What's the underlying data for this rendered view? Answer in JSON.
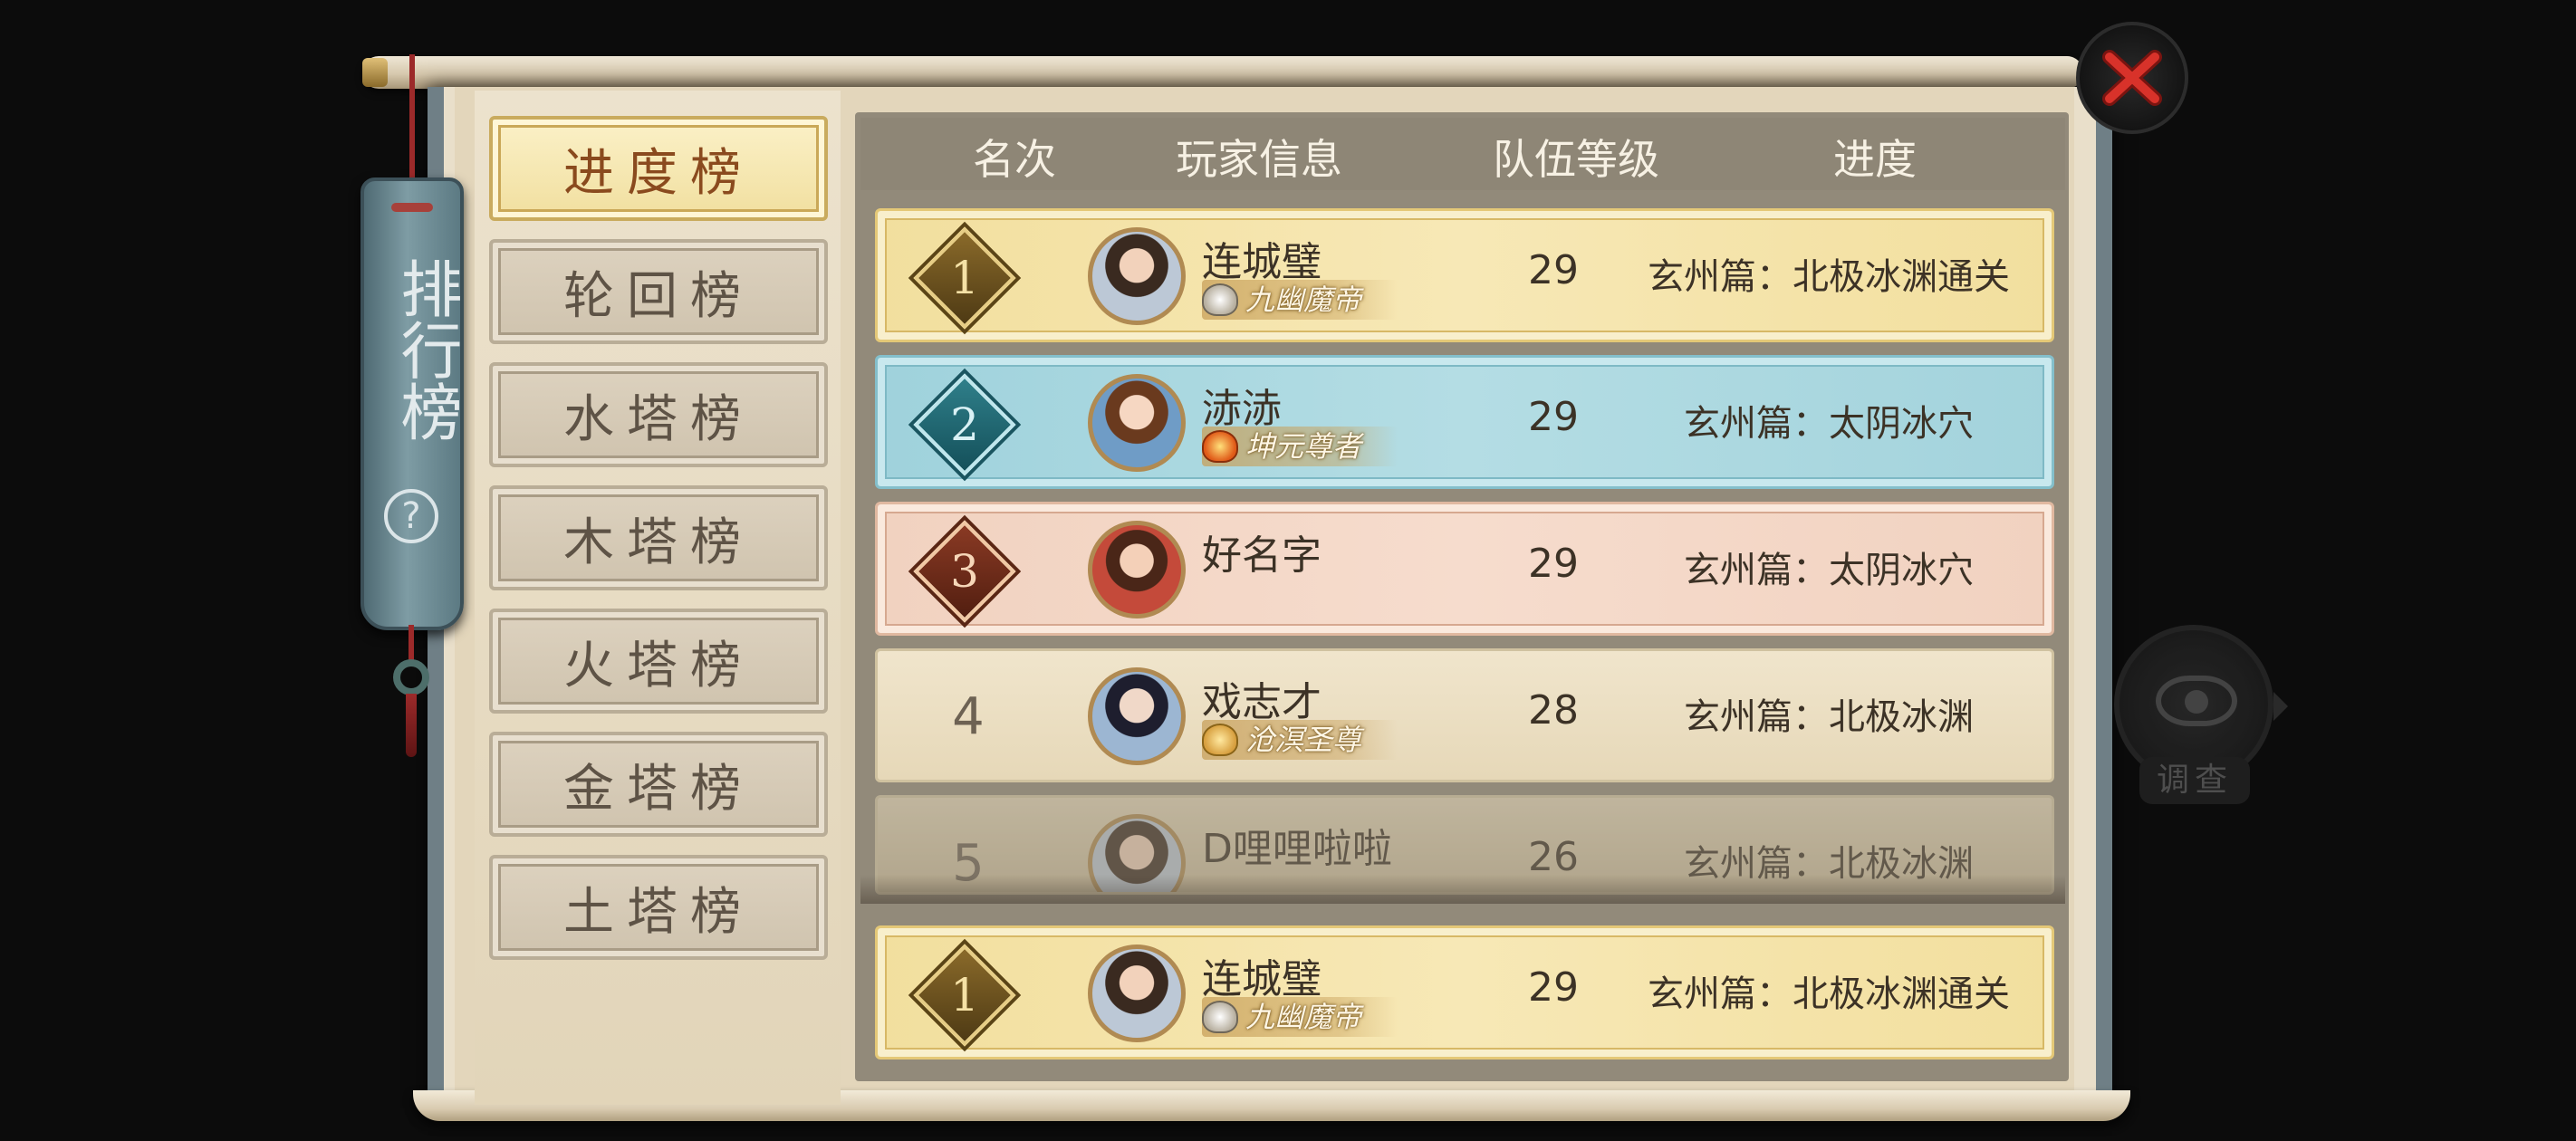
{
  "window": {
    "title": "排行榜",
    "help_glyph": "?"
  },
  "tabs": [
    {
      "label": "进度榜",
      "active": true
    },
    {
      "label": "轮回榜",
      "active": false
    },
    {
      "label": "水塔榜",
      "active": false
    },
    {
      "label": "木塔榜",
      "active": false
    },
    {
      "label": "火塔榜",
      "active": false
    },
    {
      "label": "金塔榜",
      "active": false
    },
    {
      "label": "土塔榜",
      "active": false
    }
  ],
  "table": {
    "columns": [
      "名次",
      "玩家信息",
      "队伍等级",
      "进度"
    ],
    "rows": [
      {
        "rank": "1",
        "name": "连城璧",
        "title": "九幽魔帝",
        "level": "29",
        "progress": "玄州篇：北极冰渊通关",
        "style": "gold"
      },
      {
        "rank": "2",
        "name": "浾浾",
        "title": "坤元尊者",
        "level": "29",
        "progress": "玄州篇：太阴冰穴",
        "style": "blue"
      },
      {
        "rank": "3",
        "name": "好名字",
        "title": "",
        "level": "29",
        "progress": "玄州篇：太阴冰穴",
        "style": "bronze"
      },
      {
        "rank": "4",
        "name": "戏志才",
        "title": "沧溟圣尊",
        "level": "28",
        "progress": "玄州篇：北极冰渊",
        "style": "plain"
      },
      {
        "rank": "5",
        "name": "D哩哩啦啦",
        "title": "",
        "level": "26",
        "progress": "玄州篇：北极冰渊",
        "style": "faded"
      }
    ],
    "my_rank": {
      "rank": "1",
      "name": "连城璧",
      "title": "九幽魔帝",
      "level": "29",
      "progress": "玄州篇：北极冰渊通关"
    }
  },
  "investigate": {
    "label": "调查",
    "icon": "eye-icon"
  },
  "close": {
    "icon": "close-icon"
  },
  "colors": {
    "accent_gold": "#f2df9e",
    "accent_blue": "#9fd2dc",
    "accent_bronze": "#f1d2c0",
    "close_red": "#d8322a"
  }
}
